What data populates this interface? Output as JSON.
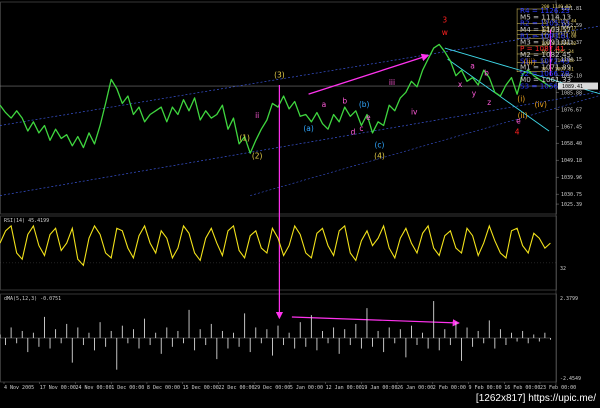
{
  "chart_data": {
    "type": "line",
    "symbol": "",
    "main": {
      "ylim": [
        1020,
        1135
      ],
      "y_ticks": [
        "1131.81",
        "1122.59",
        "1113.37",
        "1104.15",
        "1095.10",
        "1085.88",
        "1076.67",
        "1067.45",
        "1058.40",
        "1049.18",
        "1039.96",
        "1030.75",
        "1025.39"
      ],
      "y_tick_values": [
        1131.81,
        1122.59,
        1113.37,
        1104.15,
        1095.1,
        1085.88,
        1076.67,
        1067.45,
        1058.4,
        1049.18,
        1039.96,
        1030.75,
        1025.39
      ],
      "current_price": "1089.41",
      "current_value": 1089.41,
      "price_series": [
        {
          "name": "",
          "color": "#3fd63f",
          "points": [
            [
              0,
              1079
            ],
            [
              4,
              1075
            ],
            [
              8,
              1072
            ],
            [
              12,
              1076
            ],
            [
              16,
              1072
            ],
            [
              20,
              1065
            ],
            [
              24,
              1070
            ],
            [
              28,
              1064
            ],
            [
              32,
              1068
            ],
            [
              36,
              1060
            ],
            [
              40,
              1066
            ],
            [
              44,
              1061
            ],
            [
              48,
              1063
            ],
            [
              52,
              1057
            ],
            [
              56,
              1062
            ],
            [
              60,
              1056
            ],
            [
              64,
              1064
            ],
            [
              68,
              1058
            ],
            [
              72,
              1068
            ],
            [
              76,
              1080
            ],
            [
              80,
              1093
            ],
            [
              84,
              1088
            ],
            [
              88,
              1080
            ],
            [
              92,
              1084
            ],
            [
              96,
              1074
            ],
            [
              100,
              1078
            ],
            [
              104,
              1070
            ],
            [
              108,
              1074
            ],
            [
              112,
              1076
            ],
            [
              116,
              1078
            ],
            [
              120,
              1070
            ],
            [
              124,
              1078
            ],
            [
              128,
              1074
            ],
            [
              132,
              1082
            ],
            [
              136,
              1076
            ],
            [
              140,
              1083
            ],
            [
              144,
              1071
            ],
            [
              148,
              1076
            ],
            [
              152,
              1072
            ],
            [
              156,
              1074
            ],
            [
              160,
              1079
            ],
            [
              164,
              1066
            ],
            [
              168,
              1072
            ],
            [
              172,
              1058
            ],
            [
              176,
              1062
            ],
            [
              180,
              1053
            ],
            [
              184,
              1060
            ],
            [
              188,
              1066
            ],
            [
              192,
              1071
            ],
            [
              196,
              1080
            ],
            [
              200,
              1078
            ],
            [
              204,
              1084
            ],
            [
              208,
              1077
            ],
            [
              212,
              1081
            ],
            [
              216,
              1073
            ],
            [
              220,
              1074
            ],
            [
              224,
              1070
            ],
            [
              228,
              1075
            ],
            [
              232,
              1069
            ],
            [
              236,
              1066
            ],
            [
              240,
              1074
            ],
            [
              244,
              1070
            ],
            [
              248,
              1078
            ],
            [
              252,
              1073
            ],
            [
              256,
              1076
            ],
            [
              260,
              1068
            ],
            [
              264,
              1074
            ],
            [
              268,
              1064
            ],
            [
              272,
              1070
            ],
            [
              276,
              1068
            ],
            [
              280,
              1079
            ],
            [
              284,
              1076
            ],
            [
              288,
              1083
            ],
            [
              292,
              1086
            ],
            [
              296,
              1092
            ],
            [
              300,
              1089
            ],
            [
              304,
              1098
            ],
            [
              308,
              1104
            ],
            [
              312,
              1110
            ],
            [
              316,
              1112
            ],
            [
              320,
              1108
            ],
            [
              324,
              1103
            ],
            [
              328,
              1095
            ],
            [
              332,
              1098
            ],
            [
              336,
              1092
            ],
            [
              340,
              1094
            ],
            [
              344,
              1090
            ],
            [
              348,
              1098
            ],
            [
              352,
              1094
            ],
            [
              356,
              1086
            ],
            [
              360,
              1084
            ],
            [
              364,
              1090
            ],
            [
              368,
              1094
            ],
            [
              372,
              1085
            ],
            [
              376,
              1096
            ],
            [
              380,
              1098
            ],
            [
              384,
              1095
            ],
            [
              388,
              1093
            ],
            [
              392,
              1091
            ],
            [
              396,
              1089
            ]
          ]
        }
      ],
      "fib_levels": [
        {
          "label": "200  1140.03",
          "value": 1131.2
        },
        {
          "label": "161.8  1126.44",
          "value": 1123.4
        },
        {
          "label": "150.0  1124.17",
          "value": 1119.6
        },
        {
          "label": "127.2  1118.03",
          "value": 1117.3
        },
        {
          "label": "111.4  1114.00",
          "value": 1115.2
        },
        {
          "label": "100.0  1114.02",
          "value": 1111.2
        },
        {
          "label": "76.4  1105.34",
          "value": 1106.8
        },
        {
          "label": "61.8  1103.88",
          "value": 1102.1
        },
        {
          "label": "38.2  1097.61",
          "value": 1097.4
        }
      ],
      "pivots": [
        {
          "label": "R4 = 1126.23",
          "color": "#2a39ff",
          "value": 1130.0
        },
        {
          "label": "M5 = 1114.13",
          "color": "#c9c9c9",
          "value": 1126.6
        },
        {
          "label": "R2 = 1105.53",
          "color": "#2a39ff",
          "value": 1123.3
        },
        {
          "label": "M4 = 1103.57",
          "color": "#c9c9c9",
          "value": 1119.9
        },
        {
          "label": "R1 = 1093.61",
          "color": "#2a39ff",
          "value": 1116.4
        },
        {
          "label": "M3 = 1093.01",
          "color": "#c9c9c9",
          "value": 1113.0
        },
        {
          "label": "P = 1087.41",
          "color": "#ff2a2a",
          "value": 1109.6
        },
        {
          "label": "M2 = 1082.45",
          "color": "#c9c9c9",
          "value": 1106.2
        },
        {
          "label": "S1 = 1072.43",
          "color": "#2a39ff",
          "value": 1102.8
        },
        {
          "label": "M1 = 1071.89",
          "color": "#c9c9c9",
          "value": 1099.4
        },
        {
          "label": "S2 = 1066.28",
          "color": "#2a39ff",
          "value": 1096.0
        },
        {
          "label": "M0 = 1061.33",
          "color": "#c9c9c9",
          "value": 1092.6
        },
        {
          "label": "S3 = 1056.37",
          "color": "#2a39ff",
          "value": 1089.2
        }
      ],
      "wave_labels": [
        {
          "label": "(1)",
          "color": "#e8d04a",
          "x": 176,
          "y": 1060
        },
        {
          "label": "(2)",
          "color": "#e8d04a",
          "x": 185,
          "y": 1050
        },
        {
          "label": "(3)",
          "color": "#e8d04a",
          "x": 201,
          "y": 1094
        },
        {
          "label": "(4)",
          "color": "#e8d04a",
          "x": 273,
          "y": 1050
        },
        {
          "label": "(a)",
          "color": "#30a7ff",
          "x": 222,
          "y": 1065
        },
        {
          "label": "(b)",
          "color": "#30a7ff",
          "x": 262,
          "y": 1078
        },
        {
          "label": "(c)",
          "color": "#30a7ff",
          "x": 273,
          "y": 1056
        },
        {
          "label": "3",
          "color": "#ff2020",
          "x": 320,
          "y": 1124
        },
        {
          "label": "4",
          "color": "#ff2020",
          "x": 372,
          "y": 1063
        },
        {
          "label": "w",
          "color": "#ff2020",
          "x": 320,
          "y": 1117
        },
        {
          "label": "(iii)",
          "color": "#e8a020",
          "x": 381,
          "y": 1101
        },
        {
          "label": "(iv)",
          "color": "#e8a020",
          "x": 389,
          "y": 1078
        },
        {
          "label": "(ii)",
          "color": "#e8a020",
          "x": 376,
          "y": 1072
        },
        {
          "label": "(i)",
          "color": "#e8a020",
          "x": 375,
          "y": 1081
        },
        {
          "label": "iii",
          "color": "#ff5ad9",
          "x": 282,
          "y": 1090
        },
        {
          "label": "iv",
          "color": "#ff5ad9",
          "x": 298,
          "y": 1074
        },
        {
          "label": "ii",
          "color": "#ff5ad9",
          "x": 185,
          "y": 1072
        },
        {
          "label": "a",
          "color": "#ff5ad9",
          "x": 233,
          "y": 1078
        },
        {
          "label": "b",
          "color": "#ff5ad9",
          "x": 248,
          "y": 1080
        },
        {
          "label": "c",
          "color": "#ff5ad9",
          "x": 260,
          "y": 1065
        },
        {
          "label": "d",
          "color": "#ff5ad9",
          "x": 254,
          "y": 1063
        },
        {
          "label": "e",
          "color": "#ff5ad9",
          "x": 265,
          "y": 1071
        },
        {
          "label": "x",
          "color": "#ff5ad9",
          "x": 331,
          "y": 1089
        },
        {
          "label": "y",
          "color": "#ff5ad9",
          "x": 341,
          "y": 1084
        },
        {
          "label": "z",
          "color": "#ff5ad9",
          "x": 352,
          "y": 1079
        },
        {
          "label": "e",
          "color": "#ff5ad9",
          "x": 373,
          "y": 1069
        },
        {
          "label": "b",
          "color": "#ff5ad9",
          "x": 350,
          "y": 1095
        },
        {
          "label": "a",
          "color": "#ff5ad9",
          "x": 340,
          "y": 1099
        }
      ]
    },
    "rsi": {
      "label": "RSI(14) 45.4199",
      "ylim": [
        10,
        70
      ],
      "level": "32",
      "level_value": 32,
      "values": [
        48,
        58,
        62,
        40,
        35,
        55,
        62,
        46,
        38,
        55,
        60,
        42,
        48,
        60,
        35,
        30,
        52,
        62,
        55,
        40,
        36,
        60,
        58,
        44,
        36,
        54,
        62,
        48,
        40,
        58,
        52,
        36,
        44,
        62,
        56,
        40,
        34,
        52,
        60,
        48,
        38,
        58,
        62,
        42,
        36,
        54,
        58,
        44,
        40,
        60,
        52,
        38,
        46,
        62,
        55,
        40,
        36,
        56,
        60,
        46,
        38,
        58,
        62,
        40,
        34,
        50,
        58,
        46,
        52,
        62,
        44,
        36,
        52,
        60,
        48,
        40,
        56,
        62,
        44,
        38,
        54,
        58,
        44,
        40,
        60,
        54,
        38,
        48,
        62,
        50,
        40,
        36,
        58,
        60,
        46,
        40,
        56,
        52,
        44,
        48
      ]
    },
    "osc": {
      "label": "dMA(5,12,3) -0.0751",
      "ylim": [
        -2.5,
        2.5
      ],
      "top_label": "2.3799",
      "bottom_label": "-2.4549",
      "values": [
        0.2,
        -0.4,
        0.6,
        -0.3,
        0.4,
        -0.8,
        0.3,
        -0.5,
        1.2,
        -0.6,
        0.5,
        -0.3,
        0.8,
        -1.4,
        0.6,
        -0.4,
        0.3,
        -0.7,
        0.9,
        -0.5,
        0.4,
        -1.8,
        0.7,
        -0.3,
        0.5,
        -0.6,
        1.1,
        -0.4,
        0.3,
        -0.9,
        0.6,
        -0.5,
        0.4,
        -0.3,
        1.6,
        -0.7,
        0.5,
        -0.4,
        0.8,
        -1.2,
        0.4,
        -0.6,
        0.3,
        -0.5,
        1.4,
        -0.8,
        0.6,
        -0.3,
        0.5,
        -1.0,
        0.7,
        -0.4,
        0.3,
        -0.6,
        0.9,
        -0.5,
        1.3,
        -0.7,
        0.4,
        -0.3,
        0.6,
        -0.9,
        0.5,
        -0.4,
        0.8,
        -0.6,
        1.7,
        -0.5,
        0.4,
        -0.8,
        0.6,
        -0.3,
        0.5,
        -1.1,
        0.7,
        -0.4,
        0.3,
        -0.6,
        2.1,
        -0.7,
        0.5,
        -0.4,
        0.9,
        -1.3,
        0.6,
        -0.5,
        0.4,
        -0.3,
        1.0,
        -0.6,
        0.5,
        -0.4,
        0.3,
        -0.2,
        0.4,
        -0.3,
        0.2,
        -0.2,
        0.3,
        -0.1
      ]
    },
    "x_labels": [
      "4 Nov 2005",
      "17 Nov 00:00",
      "24 Nov 00:00",
      "1 Dec 00:00",
      "8 Dec 00:00",
      "15 Dec 00:00",
      "22 Dec 00:00",
      "29 Dec 00:00",
      "5 Jan 00:00",
      "12 Jan 00:00",
      "19 Jan 00:00",
      "26 Jan 00:00",
      "2 Feb 00:00",
      "9 Feb 00:00",
      "16 Feb 00:00",
      "23 Feb 00:00"
    ],
    "watermark": "[1262x817] https://upic.me/"
  },
  "colors": {
    "background": "#000000",
    "price": "#3fd63f",
    "rsi": "#f2e21a",
    "osc": "#d8d8d8",
    "channel": "#3a55d8",
    "cyan": "#3fd8e8",
    "magenta": "#ff33ee",
    "fib": "#e8d26a",
    "gridline": "#2a2a2a"
  }
}
